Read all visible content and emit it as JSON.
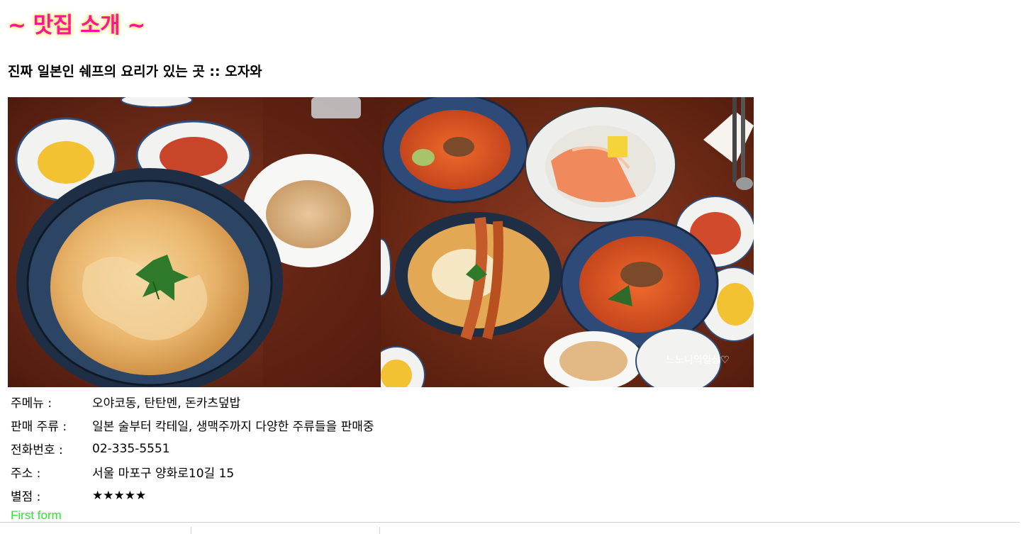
{
  "page": {
    "title": "~ 맛집 소개 ~",
    "subtitle": "진짜 일본인 쉐프의 요리가 있는 곳 :: 오자와"
  },
  "photos": {
    "left": {
      "icon": "oyakodon-photo"
    },
    "right": {
      "icon": "ramen-table-photo",
      "watermark": "느노니의일상♡"
    }
  },
  "info": {
    "rows": [
      {
        "label": "주메뉴 :",
        "value": "오야코동, 탄탄멘, 돈카츠덮밥"
      },
      {
        "label": "판매 주류 :",
        "value": "일본 술부터 칵테일, 생맥주까지 다양한 주류들을 판매중"
      },
      {
        "label": "전화번호 :",
        "value": "02-335-5551"
      },
      {
        "label": "주소 :",
        "value": "서울 마포구 양화로10길 15"
      },
      {
        "label": "별점 :",
        "value": "★★★★★"
      }
    ],
    "rating_value": 5,
    "rating_max": 5
  },
  "form": {
    "label": "First form"
  },
  "colors": {
    "title": "#ff1493",
    "title_glow": "#ffe36b",
    "form_label": "#2ee62e",
    "table_wood": "#6b2514"
  }
}
